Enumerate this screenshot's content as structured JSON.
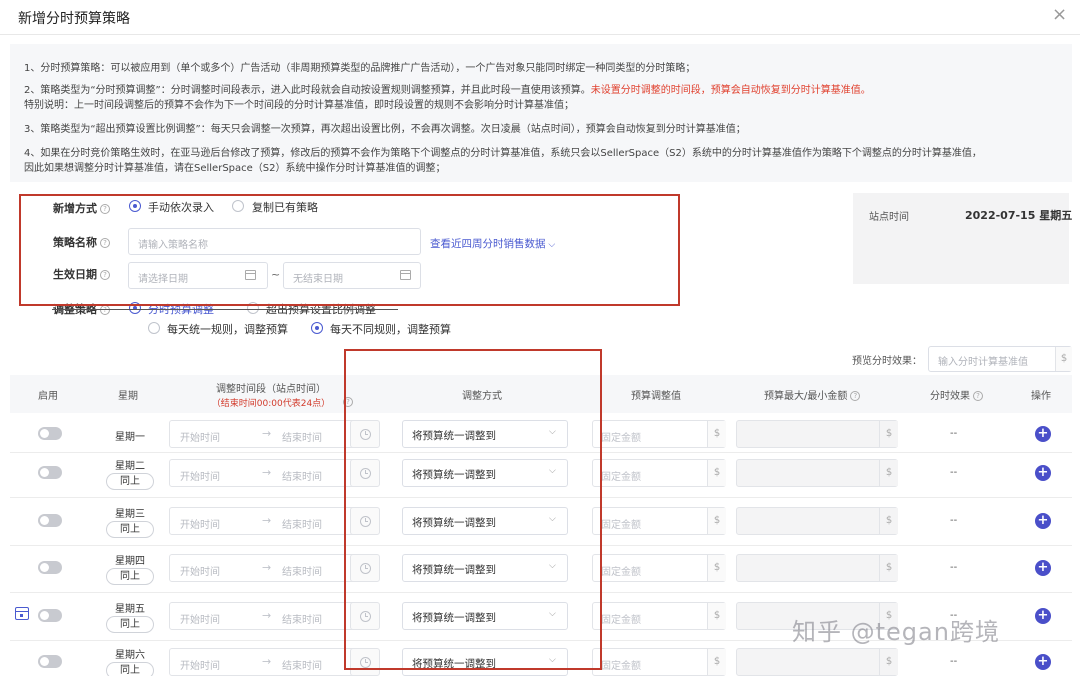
{
  "dialog": {
    "title": "新增分时预算策略",
    "close_icon": "close-icon"
  },
  "notes": {
    "n1": "1、分时预算策略：可以被应用到（单个或多个）广告活动（非周期预算类型的品牌推广广告活动），一个广告对象只能同时绑定一种同类型的分时策略；",
    "n2a": "2、策略类型为“分时预算调整”：分时调整时间段表示，进入此时段就会自动按设置规则调整预算，并且此时段一直使用该预算。",
    "n2a_red": "未设置分时调整的时间段，预算会自动恢复到分时计算基准值。",
    "n2b": "特别说明：上一时间段调整后的预算不会作为下一个时间段的分时计算基准值，即时段设置的规则不会影响分时计算基准值；",
    "n3": "3、策略类型为“超出预算设置比例调整”：每天只会调整一次预算，再次超出设置比例，不会再次调整。次日凌晨（站点时间），预算会自动恢复到分时计算基准值；",
    "n4a": "4、如果在分时竞价策略生效时，在亚马逊后台修改了预算，修改后的预算不会作为策略下个调整点的分时计算基准值，系统只会以SellerSpace（S2）系统中的分时计算基准值作为策略下个调整点的分时计算基准值，",
    "n4b": "因此如果想调整分时计算基准值，请在SellerSpace（S2）系统中操作分时计算基准值的调整；"
  },
  "form": {
    "add_method_label": "新增方式",
    "add_method_opt1": "手动依次录入",
    "add_method_opt2": "复制已有策略",
    "name_label": "策略名称",
    "name_placeholder": "请输入策略名称",
    "view_sales_link": "查看近四周分时销售数据",
    "date_label": "生效日期",
    "start_placeholder": "请选择日期",
    "date_sep": "~",
    "end_placeholder": "无结束日期",
    "strategy_label": "调整策略",
    "strategy_opt1": "分时预算调整",
    "strategy_opt2": "超出预算设置比例调整",
    "rule_opt1": "每天统一规则，调整预算",
    "rule_opt2": "每天不同规则，调整预算"
  },
  "site": {
    "label": "站点时间",
    "value": "2022-07-15  星期五"
  },
  "preview": {
    "label": "预览分时效果：",
    "placeholder": "输入分时计算基准值",
    "unit": "$"
  },
  "table": {
    "headers": {
      "enable": "启用",
      "weekday": "星期",
      "period": "调整时间段（站点时间）",
      "period_note": "（结束时间00:00代表24点）",
      "method": "调整方式",
      "value": "预算调整值",
      "maxmin": "预算最大/最小金额",
      "effect": "分时效果",
      "action": "操作"
    },
    "start_ph": "开始时间",
    "end_ph": "结束时间",
    "arrow": "→",
    "method_value": "将预算统一调整到",
    "amount_ph": "固定金额",
    "unit": "$",
    "dash": "--",
    "same_label": "同上",
    "add_icon": "+",
    "rows": [
      {
        "day": "星期一"
      },
      {
        "day": "星期二"
      },
      {
        "day": "星期三"
      },
      {
        "day": "星期四"
      },
      {
        "day": "星期五"
      },
      {
        "day": "星期六"
      }
    ]
  },
  "watermark": "知乎 @tegan跨境",
  "colors": {
    "accent": "#4a5ad0",
    "annotation_red": "#c0392b",
    "warning_red": "#e0412f"
  }
}
